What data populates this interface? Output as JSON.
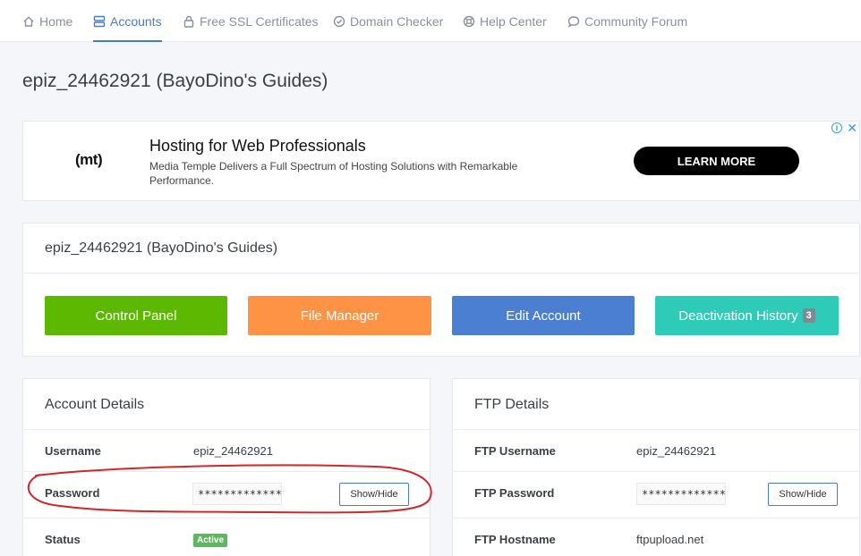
{
  "nav": {
    "items": [
      {
        "label": "Home",
        "icon": "home-icon"
      },
      {
        "label": "Accounts",
        "icon": "server-icon",
        "active": true
      },
      {
        "label": "Free SSL Certificates",
        "icon": "lock-icon"
      },
      {
        "label": "Domain Checker",
        "icon": "check-circle-icon"
      },
      {
        "label": "Help Center",
        "icon": "lifebuoy-icon"
      },
      {
        "label": "Community Forum",
        "icon": "comment-icon"
      }
    ]
  },
  "page": {
    "title": "epiz_24462921 (BayoDino's Guides)"
  },
  "ad": {
    "logo": "(mt)",
    "headline": "Hosting for Web Professionals",
    "text": "Media Temple Delivers a Full Spectrum of Hosting Solutions with Remarkable Performance.",
    "cta": "LEARN MORE",
    "info": "i",
    "close": "✕"
  },
  "account_card": {
    "title": "epiz_24462921 (BayoDino's Guides)",
    "buttons": {
      "control_panel": "Control Panel",
      "file_manager": "File Manager",
      "edit_account": "Edit Account",
      "deactivation_history": "Deactivation History",
      "deactivation_count": "3"
    },
    "colors": {
      "control_panel": "#5cb800",
      "file_manager": "#ff9345",
      "edit_account": "#4a7fd2",
      "deactivation_history": "#2ecbb8"
    }
  },
  "account_details": {
    "title": "Account Details",
    "username_label": "Username",
    "username": "epiz_24462921",
    "password_label": "Password",
    "password_mask": "*************",
    "show_hide": "Show/Hide",
    "status_label": "Status",
    "status": "Active"
  },
  "ftp_details": {
    "title": "FTP Details",
    "username_label": "FTP Username",
    "username": "epiz_24462921",
    "password_label": "FTP Password",
    "password_mask": "*************",
    "show_hide": "Show/Hide",
    "hostname_label": "FTP Hostname",
    "hostname": "ftpupload.net"
  },
  "annotation": {
    "color": "#d0262c"
  }
}
